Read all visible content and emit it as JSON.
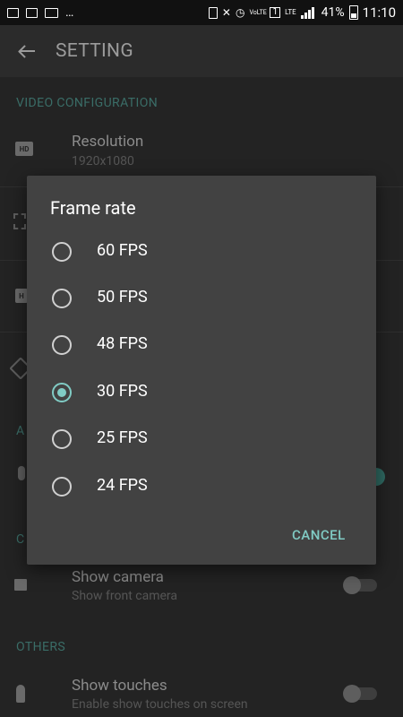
{
  "status_bar": {
    "battery": "41%",
    "time": "11:10",
    "network": "LTE",
    "volte": "VoLTE",
    "sim": "1",
    "left_icons": [
      "image-icon",
      "app-notification-icon",
      "video-icon",
      "more-icon"
    ],
    "right_icons": [
      "nfc-icon",
      "mute-icon",
      "alarm-icon",
      "signal-icon",
      "battery-icon"
    ]
  },
  "app_bar": {
    "title": "SETTING"
  },
  "settings": {
    "section_video": "VIDEO CONFIGURATION",
    "resolution_title": "Resolution",
    "resolution_value": "1920x1080",
    "section_audio_partial": "A",
    "section_camera_partial": "C",
    "show_camera_title": "Show camera",
    "show_camera_sub": "Show front camera",
    "section_others": "OTHERS",
    "show_touches_title": "Show touches",
    "show_touches_sub": "Enable show touches on screen"
  },
  "dialog": {
    "title": "Frame rate",
    "options": [
      {
        "label": "60 FPS",
        "checked": false
      },
      {
        "label": "50 FPS",
        "checked": false
      },
      {
        "label": "48 FPS",
        "checked": false
      },
      {
        "label": "30 FPS",
        "checked": true
      },
      {
        "label": "25 FPS",
        "checked": false
      },
      {
        "label": "24 FPS",
        "checked": false
      }
    ],
    "cancel_label": "CANCEL"
  },
  "colors": {
    "accent": "#80cbc4",
    "dialog_bg": "#424242",
    "page_bg": "#232323"
  }
}
